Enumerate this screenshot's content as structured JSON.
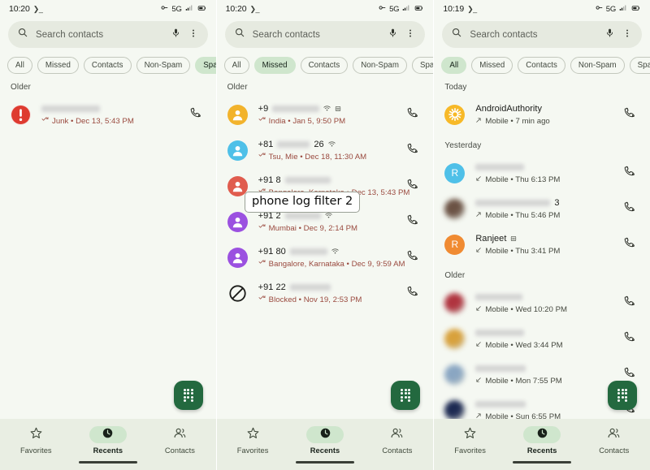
{
  "meta": {
    "annotation": "phone log filter 2"
  },
  "status_bar": {
    "time_p1": "10:20",
    "time_p2": "10:20",
    "time_p3": "10:19",
    "terminal_glyph": "❯_",
    "network": "5G",
    "icons": [
      "vpn-key-icon",
      "network-5g-icon",
      "signal-bars-icon",
      "battery-icon"
    ]
  },
  "search": {
    "placeholder": "Search contacts",
    "search_icon": "search-icon",
    "mic_icon": "microphone-icon",
    "overflow_icon": "more-vert-icon"
  },
  "filter_chips": {
    "labels": [
      "All",
      "Missed",
      "Contacts",
      "Non-Spam",
      "Spam"
    ],
    "selected_p1": "Spam",
    "selected_p2": "Missed",
    "selected_p3": "All"
  },
  "bottom_nav": {
    "items": [
      {
        "label": "Favorites",
        "icon": "star-outline-icon",
        "active": false
      },
      {
        "label": "Recents",
        "icon": "clock-filled-icon",
        "active": true
      },
      {
        "label": "Contacts",
        "icon": "contacts-icon",
        "active": false
      }
    ]
  },
  "fab": {
    "icon": "dialpad-icon",
    "color": "#23693f"
  },
  "colors": {
    "page_bg": "#f5f8f2",
    "search_bg": "#e6eae0",
    "chip_selected": "#cfe6cd",
    "nav_bg": "#e9eee3",
    "fab_green": "#23693f",
    "spam_red": "#9a4a3f",
    "avatar_amber": "#f2b32c",
    "avatar_blue": "#4fc0e8",
    "avatar_red": "#e05c4e",
    "avatar_purple": "#9b51e0",
    "avatar_orange": "#f08b32"
  },
  "panel1": {
    "sections": [
      {
        "header": "Older",
        "rows": [
          {
            "avatar": {
              "type": "spam-warning-icon",
              "color": "#de3b30"
            },
            "name": "",
            "name_redacted": true,
            "redact_width": 72,
            "badges": [],
            "direction_icon": "missed-call-icon",
            "subtitle": "Junk • Dec 13, 5:43 PM",
            "subtitle_style": "spam",
            "call_icon": "call-back-icon"
          }
        ]
      }
    ]
  },
  "panel2": {
    "sections": [
      {
        "header": "Older",
        "rows": [
          {
            "avatar": {
              "type": "person-icon",
              "color": "#f2b32c"
            },
            "name": "+9",
            "name_redacted": true,
            "redact_width": 58,
            "badges": [
              "wifi-call-icon",
              "sim-card-icon"
            ],
            "direction_icon": "missed-call-icon",
            "subtitle": "India • Jan 5, 9:50 PM",
            "subtitle_style": "spam",
            "call_icon": "call-back-icon"
          },
          {
            "avatar": {
              "type": "person-icon",
              "color": "#4fc0e8"
            },
            "name": "+81",
            "name_suffix": "26",
            "name_redacted": true,
            "redact_width": 40,
            "badges": [
              "wifi-call-icon"
            ],
            "direction_icon": "missed-call-icon",
            "subtitle": "Tsu, Mie • Dec 18, 11:30 AM",
            "subtitle_style": "spam",
            "call_icon": "call-back-icon"
          },
          {
            "avatar": {
              "type": "person-icon",
              "color": "#e05c4e"
            },
            "name": "+91 8",
            "name_redacted": true,
            "redact_width": 56,
            "badges": [],
            "direction_icon": "missed-call-icon",
            "subtitle": "Bangalore, Karnataka • Dec 13, 5:43 PM",
            "subtitle_style": "spam",
            "call_icon": "call-back-icon"
          },
          {
            "avatar": {
              "type": "person-icon",
              "color": "#9b51e0"
            },
            "name": "+91 2",
            "name_redacted": true,
            "redact_width": 44,
            "badges": [
              "wifi-call-icon"
            ],
            "direction_icon": "missed-call-icon",
            "subtitle": "Mumbai • Dec 9, 2:14 PM",
            "subtitle_style": "spam",
            "call_icon": "call-back-icon"
          },
          {
            "avatar": {
              "type": "person-icon",
              "color": "#9b51e0"
            },
            "name": "+91 80",
            "name_redacted": true,
            "redact_width": 46,
            "badges": [
              "wifi-call-icon"
            ],
            "direction_icon": "missed-call-icon",
            "subtitle": "Bangalore, Karnataka • Dec 9, 9:59 AM",
            "subtitle_style": "spam",
            "call_icon": "call-back-icon"
          },
          {
            "avatar": {
              "type": "blocked-icon",
              "color": "#1b1c19"
            },
            "name": "+91 22",
            "name_redacted": true,
            "redact_width": 50,
            "badges": [],
            "direction_icon": "missed-call-icon",
            "subtitle": "Blocked • Nov 19, 2:53 PM",
            "subtitle_style": "spam",
            "call_icon": "call-back-icon"
          }
        ]
      }
    ]
  },
  "panel3": {
    "sections": [
      {
        "header": "Today",
        "rows": [
          {
            "avatar": {
              "type": "sun-logo-icon",
              "color": "#f7b928"
            },
            "name": "AndroidAuthority",
            "name_redacted": false,
            "badges": [],
            "direction_icon": "outgoing-call-icon",
            "subtitle": "Mobile • 7 min ago",
            "subtitle_style": "normal",
            "call_icon": "call-back-icon"
          }
        ]
      },
      {
        "header": "Yesterday",
        "rows": [
          {
            "avatar": {
              "type": "letter-icon",
              "color": "#4fc0e8",
              "letter": "R"
            },
            "name": "",
            "name_redacted": true,
            "redact_width": 60,
            "badges": [],
            "direction_icon": "incoming-call-icon",
            "subtitle": "Mobile • Thu 6:13 PM",
            "subtitle_style": "normal",
            "call_icon": "call-back-icon"
          },
          {
            "avatar": {
              "type": "photo-avatar",
              "color": "#6b5244"
            },
            "name": "",
            "name_suffix": "3",
            "name_redacted": true,
            "redact_width": 92,
            "badges": [],
            "direction_icon": "outgoing-call-icon",
            "subtitle": "Mobile • Thu 5:46 PM",
            "subtitle_style": "normal",
            "call_icon": "call-back-icon"
          },
          {
            "avatar": {
              "type": "letter-icon",
              "color": "#f08b32",
              "letter": "R"
            },
            "name": "Ranjeet",
            "name_redacted": false,
            "badges": [
              "sim-card-icon"
            ],
            "direction_icon": "incoming-call-icon",
            "subtitle": "Mobile • Thu 3:41 PM",
            "subtitle_style": "normal",
            "call_icon": "call-back-icon"
          }
        ]
      },
      {
        "header": "Older",
        "rows": [
          {
            "avatar": {
              "type": "photo-avatar",
              "color": "#b0343f"
            },
            "name": "",
            "name_redacted": true,
            "redact_width": 58,
            "badges": [],
            "direction_icon": "incoming-call-icon",
            "subtitle": "Mobile • Wed 10:20 PM",
            "subtitle_style": "normal",
            "call_icon": "call-back-icon"
          },
          {
            "avatar": {
              "type": "photo-avatar",
              "color": "#d8a13c"
            },
            "name": "",
            "name_redacted": true,
            "redact_width": 60,
            "badges": [],
            "direction_icon": "incoming-call-icon",
            "subtitle": "Mobile • Wed 3:44 PM",
            "subtitle_style": "normal",
            "call_icon": "call-back-icon"
          },
          {
            "avatar": {
              "type": "photo-avatar",
              "color": "#8aa6c2"
            },
            "name": "",
            "name_redacted": true,
            "redact_width": 62,
            "badges": [],
            "direction_icon": "incoming-call-icon",
            "subtitle": "Mobile • Mon 7:55 PM",
            "subtitle_style": "normal",
            "call_icon": "call-back-icon"
          },
          {
            "avatar": {
              "type": "photo-avatar",
              "color": "#1d2a52"
            },
            "name": "",
            "name_redacted": true,
            "redact_width": 62,
            "badges": [],
            "direction_icon": "outgoing-call-icon",
            "subtitle": "Mobile • Sun 6:55 PM",
            "subtitle_style": "normal",
            "call_icon": "call-back-icon"
          }
        ]
      }
    ]
  }
}
